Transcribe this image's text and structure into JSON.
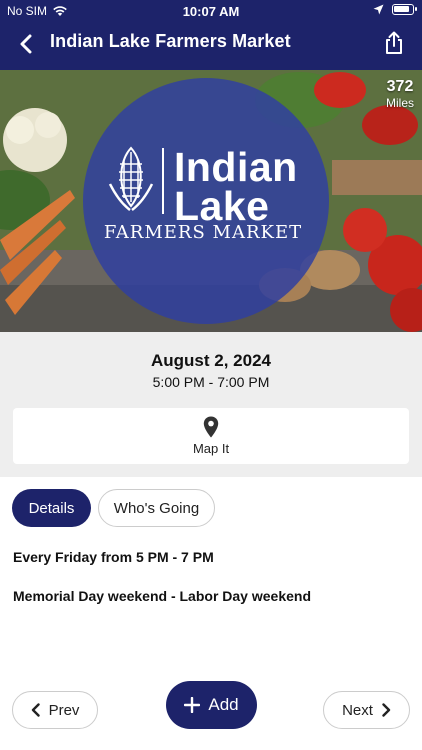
{
  "status_bar": {
    "carrier": "No SIM",
    "time": "10:07 AM"
  },
  "nav": {
    "title": "Indian Lake Farmers Market",
    "back_icon": "chevron-left-icon",
    "share_icon": "share-icon"
  },
  "hero": {
    "distance_value": "372",
    "distance_unit": "Miles",
    "logo": {
      "line1": "Indian",
      "line2": "Lake",
      "line3": "FARMERS MARKET"
    }
  },
  "event": {
    "date": "August 2, 2024",
    "time_range": "5:00 PM - 7:00 PM",
    "map_label": "Map It"
  },
  "tabs": [
    {
      "label": "Details",
      "active": true
    },
    {
      "label": "Who's Going",
      "active": false
    }
  ],
  "details": {
    "lines": [
      "Every Friday from 5 PM - 7 PM",
      "Memorial Day weekend - Labor Day weekend"
    ]
  },
  "footer": {
    "prev_label": "Prev",
    "add_label": "Add",
    "next_label": "Next"
  },
  "colors": {
    "brand_navy": "#1d236a",
    "logo_blue": "#3040a0",
    "panel_gray": "#eeeeee"
  }
}
